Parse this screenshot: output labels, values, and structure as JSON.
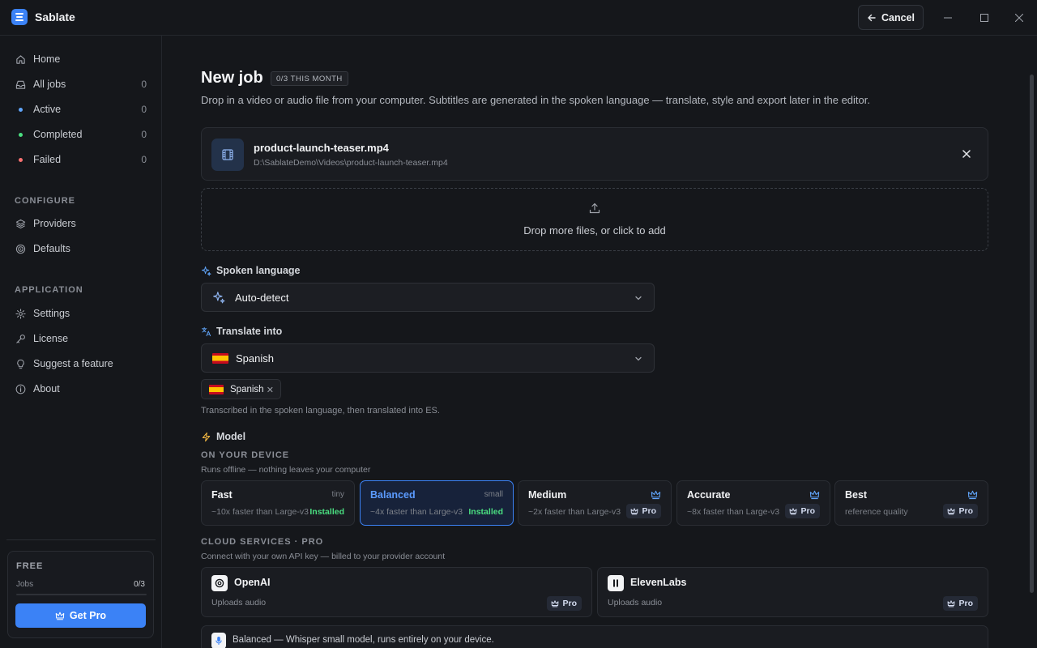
{
  "app": {
    "title": "Sablate",
    "cancel_label": "Cancel"
  },
  "sidebar": {
    "nav": [
      {
        "label": "Home",
        "icon": "home-icon"
      },
      {
        "label": "All jobs",
        "icon": "inbox-icon",
        "count": "0"
      },
      {
        "label": "Active",
        "dot": "#60a5fa",
        "count": "0"
      },
      {
        "label": "Completed",
        "dot": "#4ade80",
        "count": "0"
      },
      {
        "label": "Failed",
        "dot": "#f87171",
        "count": "0"
      }
    ],
    "configure_label": "CONFIGURE",
    "configure": [
      {
        "label": "Providers",
        "icon": "layers-icon"
      },
      {
        "label": "Defaults",
        "icon": "target-icon"
      }
    ],
    "application_label": "APPLICATION",
    "application": [
      {
        "label": "Settings",
        "icon": "gear-icon"
      },
      {
        "label": "License",
        "icon": "key-icon"
      },
      {
        "label": "Suggest a feature",
        "icon": "lightbulb-icon"
      },
      {
        "label": "About",
        "icon": "info-icon"
      }
    ],
    "plan": {
      "name": "FREE",
      "jobs_label": "Jobs",
      "jobs_count": "0/3",
      "usage_fraction": 0,
      "cta": "Get Pro"
    }
  },
  "main": {
    "title": "New job",
    "month_badge": "0/3 THIS MONTH",
    "description": "Drop in a video or audio file from your computer. Subtitles are generated in the spoken language — translate, style and export later in the editor.",
    "file": {
      "name": "product-launch-teaser.mp4",
      "path": "D:\\SablateDemo\\Videos\\product-launch-teaser.mp4"
    },
    "dropzone_text": "Drop more files, or click to add",
    "spoken_language": {
      "label": "Spoken language",
      "value": "Auto-detect"
    },
    "translate": {
      "label": "Translate into",
      "value": "Spanish",
      "chip": "Spanish",
      "hint": "Transcribed in the spoken language, then translated into ES."
    },
    "model": {
      "label": "Model",
      "device_label": "ON YOUR DEVICE",
      "device_hint": "Runs offline — nothing leaves your computer",
      "options": [
        {
          "name": "Fast",
          "size": "tiny",
          "sub": "~10x faster than Large-v3",
          "status": "Installed"
        },
        {
          "name": "Balanced",
          "size": "small",
          "sub": "~4x faster than Large-v3",
          "status": "Installed",
          "selected": true
        },
        {
          "name": "Medium",
          "sub": "~2x faster than Large-v3",
          "badge": "Pro"
        },
        {
          "name": "Accurate",
          "sub": "~8x faster than Large-v3",
          "badge": "Pro"
        },
        {
          "name": "Best",
          "sub": "reference quality",
          "badge": "Pro"
        }
      ]
    },
    "cloud": {
      "label": "CLOUD SERVICES · PRO",
      "hint": "Connect with your own API key — billed to your provider account",
      "providers": [
        {
          "name": "OpenAI",
          "sub": "Uploads audio",
          "badge": "Pro"
        },
        {
          "name": "ElevenLabs",
          "sub": "Uploads audio",
          "badge": "Pro"
        }
      ]
    },
    "summary": "Balanced — Whisper small model, runs entirely on your device."
  },
  "colors": {
    "accent": "#3b82f6",
    "installed": "#4ade80",
    "crown": "#60a5fa",
    "sparkle": "#60a5fa",
    "bolt": "#f5b942"
  }
}
